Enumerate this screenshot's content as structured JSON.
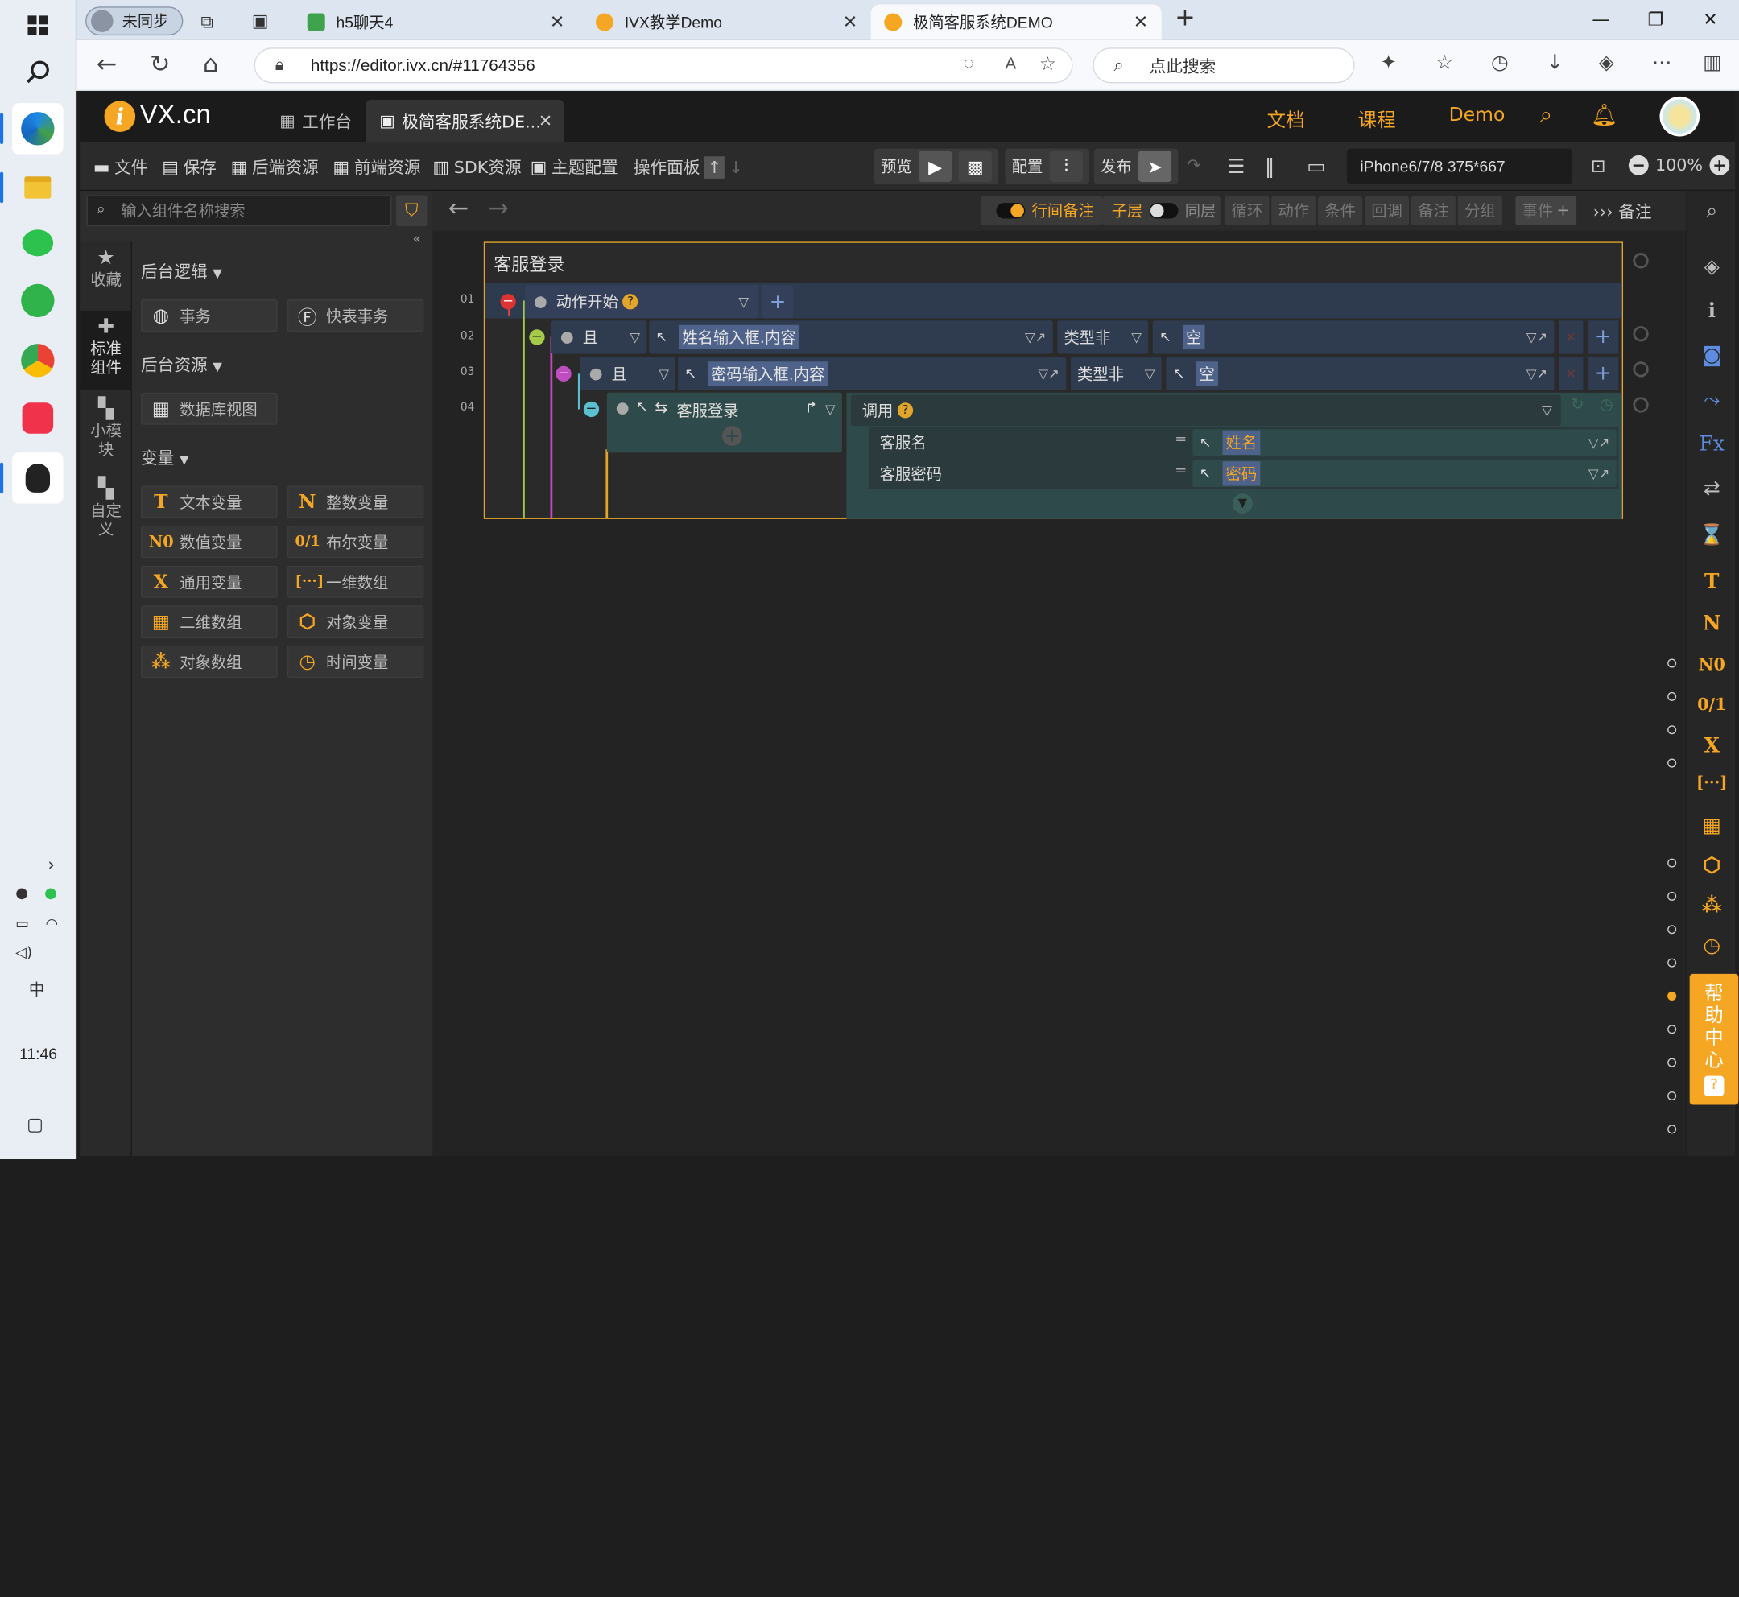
{
  "taskbar": {
    "clock": "11:46",
    "ime": "中"
  },
  "browser": {
    "profile": "未同步",
    "tabs": [
      {
        "label": "h5聊天4"
      },
      {
        "label": "IVX教学Demo"
      },
      {
        "label": "极简客服系统DEMO"
      }
    ],
    "url": "https://editor.ivx.cn/#11764356",
    "search_placeholder": "点此搜索"
  },
  "app": {
    "logo": "VX.cn",
    "logo_mark": "i",
    "tabs": [
      {
        "label": "工作台"
      },
      {
        "label": "极简客服系统DE..."
      }
    ],
    "header_links": [
      "文档",
      "课程",
      "Demo"
    ],
    "toolbar": {
      "file": "文件",
      "save": "保存",
      "backend": "后端资源",
      "frontend": "前端资源",
      "sdk": "SDK资源",
      "theme": "主题配置",
      "panel": "操作面板",
      "preview": "预览",
      "config": "配置",
      "publish": "发布",
      "device": "iPhone6/7/8 375*667",
      "zoom": "100%"
    },
    "left_panel": {
      "search_placeholder": "输入组件名称搜索",
      "rail": [
        {
          "label": "收藏"
        },
        {
          "label": "标准组件"
        },
        {
          "label": "小模块"
        },
        {
          "label": "自定义"
        }
      ],
      "categories": {
        "backend_logic": "后台逻辑",
        "backend_resource": "后台资源",
        "variables": "变量"
      },
      "components": {
        "transaction": "事务",
        "quick_transaction": "快表事务",
        "db_view": "数据库视图",
        "text_var": "文本变量",
        "int_var": "整数变量",
        "num_var": "数值变量",
        "bool_var": "布尔变量",
        "generic_var": "通用变量",
        "array_1d": "一维数组",
        "array_2d": "二维数组",
        "object_var": "对象变量",
        "object_array": "对象数组",
        "time_var": "时间变量"
      }
    },
    "editor_bar": {
      "line_note": "行间备注",
      "child": "子层",
      "sibling": "同层",
      "loop": "循环",
      "action": "动作",
      "condition": "条件",
      "callback": "回调",
      "note": "备注",
      "group": "分组",
      "event": "事件",
      "note2": "备注"
    },
    "logic": {
      "title": "客服登录",
      "line_numbers": [
        "01",
        "02",
        "03",
        "04"
      ],
      "row1": {
        "label": "动作开始"
      },
      "row2": {
        "op": "且",
        "target": "姓名输入框.内容",
        "cond": "类型非",
        "value": "空"
      },
      "row3": {
        "op": "且",
        "target": "密码输入框.内容",
        "cond": "类型非",
        "value": "空"
      },
      "row4": {
        "target": "客服登录",
        "action": "调用"
      },
      "params": [
        {
          "name": "客服名",
          "eq": "=",
          "value": "姓名"
        },
        {
          "name": "客服密码",
          "eq": "=",
          "value": "密码"
        }
      ]
    },
    "right_rail": {
      "glyphs": {
        "text": "T",
        "int": "N",
        "num": "N0",
        "bool": "0/1",
        "generic": "X",
        "fx": "Fx"
      },
      "help": "帮助中心"
    }
  }
}
